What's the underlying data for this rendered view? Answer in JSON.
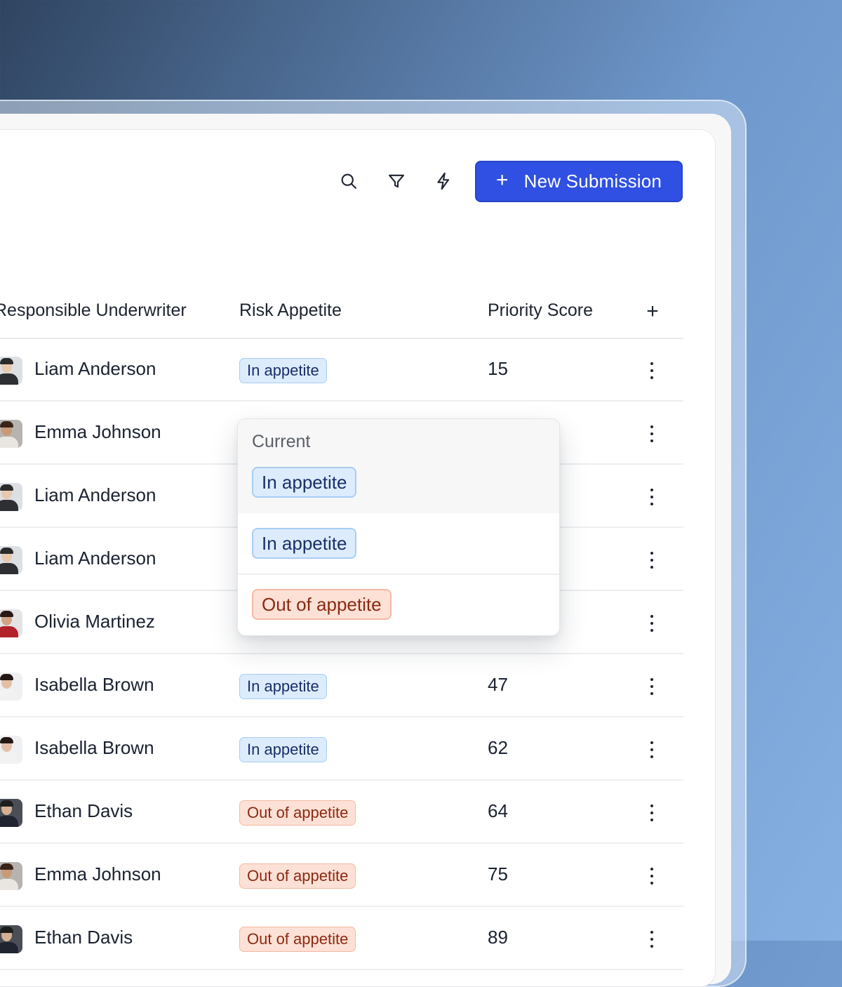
{
  "toolbar": {
    "icons": [
      "search-icon",
      "filter-icon",
      "lightning-icon"
    ],
    "new_button": {
      "icon": "+",
      "label": "New Submission"
    }
  },
  "table": {
    "columns": [
      "Responsible Underwriter",
      "Risk Appetite",
      "Priority Score"
    ],
    "add_column_icon": "+",
    "rows": [
      {
        "underwriter": "Liam Anderson",
        "appetite": "In appetite",
        "status": "in",
        "score": "15"
      },
      {
        "underwriter": "Emma Johnson",
        "appetite": "",
        "status": "",
        "score": ""
      },
      {
        "underwriter": "Liam Anderson",
        "appetite": "",
        "status": "",
        "score": ""
      },
      {
        "underwriter": "Liam Anderson",
        "appetite": "",
        "status": "",
        "score": ""
      },
      {
        "underwriter": "Olivia Martinez",
        "appetite": "",
        "status": "",
        "score": ""
      },
      {
        "underwriter": "Isabella Brown",
        "appetite": "In appetite",
        "status": "in",
        "score": "47"
      },
      {
        "underwriter": "Isabella Brown",
        "appetite": "In appetite",
        "status": "in",
        "score": "62"
      },
      {
        "underwriter": "Ethan Davis",
        "appetite": "Out of appetite",
        "status": "out",
        "score": "64"
      },
      {
        "underwriter": "Emma Johnson",
        "appetite": "Out of appetite",
        "status": "out",
        "score": "75"
      },
      {
        "underwriter": "Ethan Davis",
        "appetite": "Out of appetite",
        "status": "out",
        "score": "89"
      }
    ]
  },
  "dropdown": {
    "current_label": "Current",
    "current_value": "In appetite",
    "options": [
      "In appetite",
      "Out of appetite"
    ]
  },
  "colors": {
    "accent": "#2f50e2",
    "in_badge_bg": "#dcecfd",
    "out_badge_bg": "#fde1d6"
  }
}
